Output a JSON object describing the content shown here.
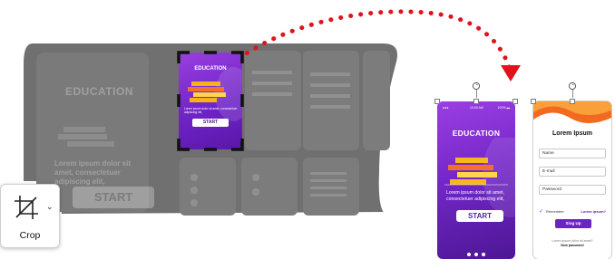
{
  "canvas": {
    "ghost_big": {
      "title": "EDUCATION",
      "body": "Lorem ipsum dolor sit amet, consectetuer adipiscing elit,",
      "start": "START"
    },
    "crop_target": {
      "title": "EDUCATION",
      "body": "Lorem ipsum dolor sit amet, consectetuer adipiscing elit,",
      "start": "START"
    }
  },
  "crop_tool": {
    "label": "Crop",
    "icon": "crop-icon",
    "caret_icon": "chevron-down-icon"
  },
  "mockups": [
    {
      "name": "education",
      "status": {
        "left": "●●●",
        "center": "10:00 AM",
        "right": "100% ▬"
      },
      "title": "EDUCATION",
      "body": "Lorem ipsum dolor sit amet, consectetuer adipiscing elit,",
      "start": "START"
    },
    {
      "name": "login",
      "title": "Lorem Ipsum",
      "fields": [
        "Name",
        "E-mail",
        "Password"
      ],
      "remember": "Remember",
      "forgot": "Lorem ipsum?",
      "signup": "Sing Up",
      "account_line": "Lorem ipsum dolor sit amet?",
      "account_link": "New password"
    }
  ],
  "colors": {
    "accent_purple": "#7427c9",
    "arrow_red": "#e0131b",
    "login_orange": "#f26a1f",
    "dim_overlay": "#6e6e6e"
  }
}
